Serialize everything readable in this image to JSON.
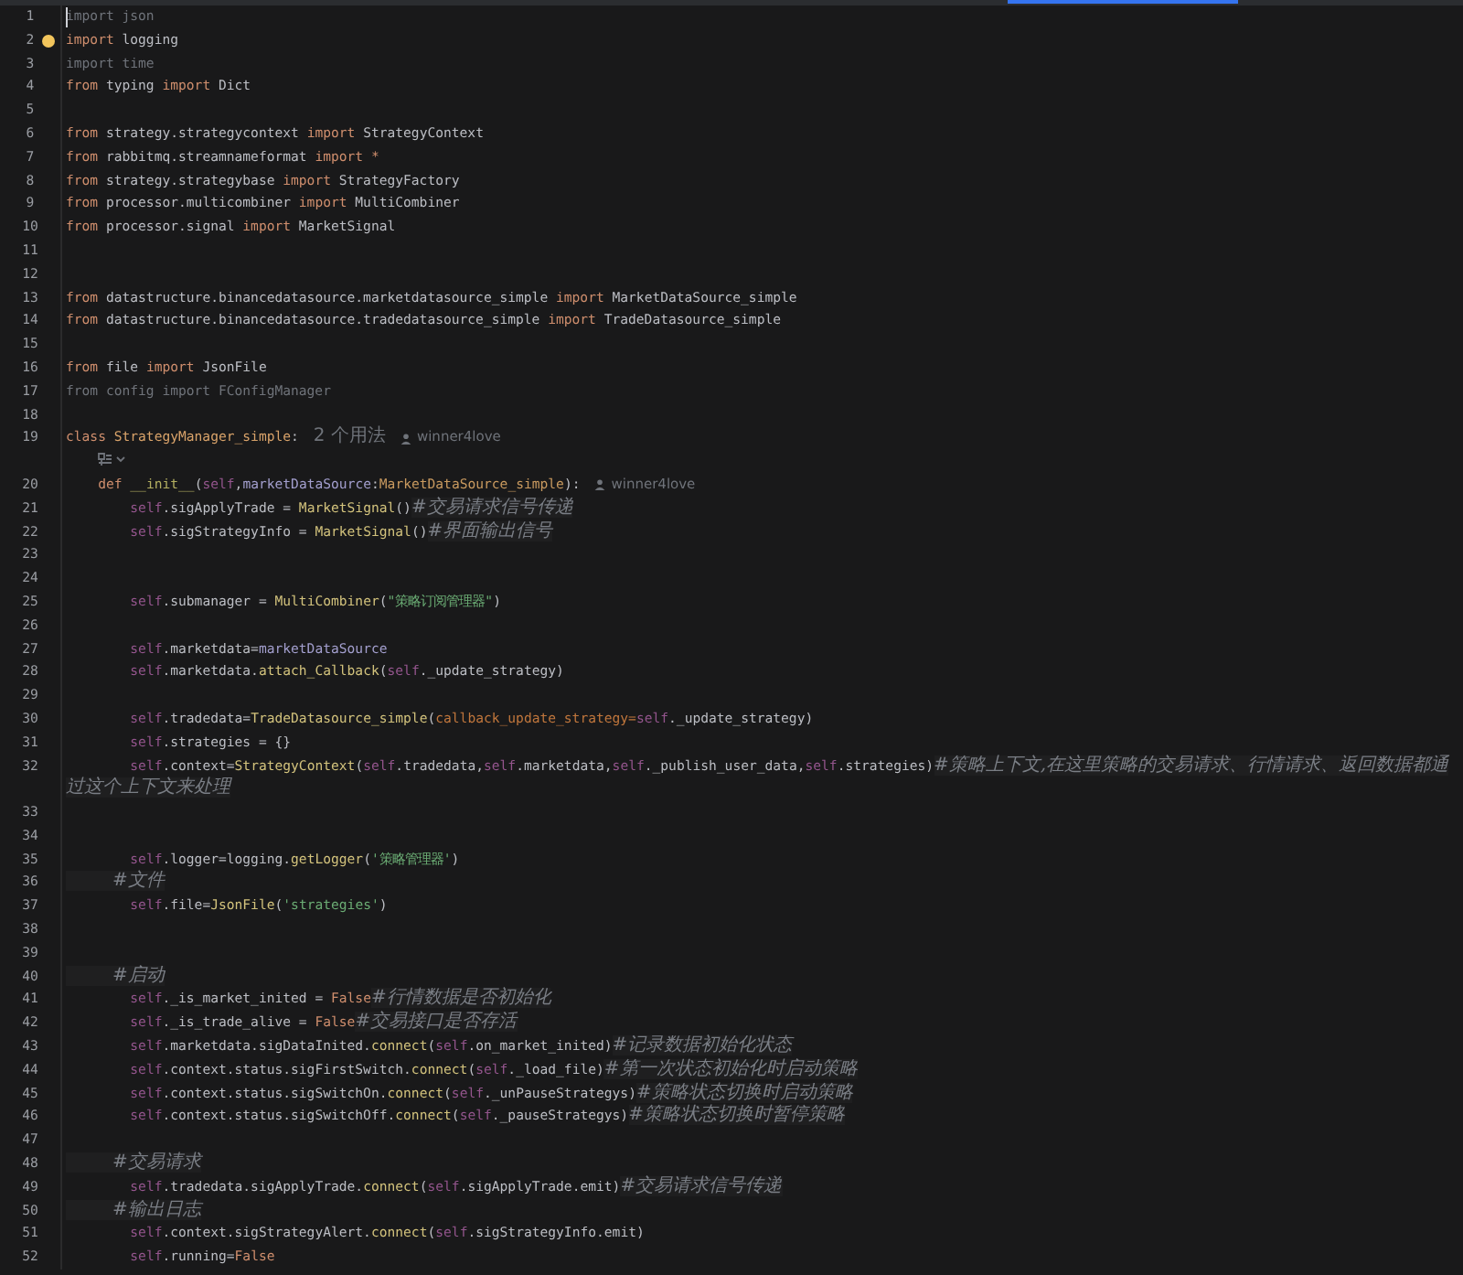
{
  "editor": {
    "lines": [
      {
        "kind": "code",
        "number": "1",
        "caret": true,
        "tokens": [
          {
            "kind": "dim",
            "text": "import json"
          }
        ]
      },
      {
        "kind": "code",
        "number": "2",
        "bulb": true,
        "tokens": [
          {
            "kind": "kw",
            "text": "import"
          },
          {
            "kind": "plain",
            "text": " logging"
          }
        ]
      },
      {
        "kind": "code",
        "number": "3",
        "tokens": [
          {
            "kind": "dim",
            "text": "import time"
          }
        ]
      },
      {
        "kind": "code",
        "number": "4",
        "tokens": [
          {
            "kind": "kw",
            "text": "from"
          },
          {
            "kind": "plain",
            "text": " typing "
          },
          {
            "kind": "kw",
            "text": "import"
          },
          {
            "kind": "plain",
            "text": " Dict"
          }
        ]
      },
      {
        "kind": "code",
        "number": "5"
      },
      {
        "kind": "code",
        "number": "6",
        "tokens": [
          {
            "kind": "kw",
            "text": "from"
          },
          {
            "kind": "plain",
            "text": " strategy.strategycontext "
          },
          {
            "kind": "kw",
            "text": "import"
          },
          {
            "kind": "plain",
            "text": " StrategyContext"
          }
        ]
      },
      {
        "kind": "code",
        "number": "7",
        "tokens": [
          {
            "kind": "kw",
            "text": "from"
          },
          {
            "kind": "plain",
            "text": " rabbitmq.streamnameformat "
          },
          {
            "kind": "kw",
            "text": "import"
          },
          {
            "kind": "kw",
            "text": " *"
          }
        ]
      },
      {
        "kind": "code",
        "number": "8",
        "tokens": [
          {
            "kind": "kw",
            "text": "from"
          },
          {
            "kind": "plain",
            "text": " strategy.strategybase "
          },
          {
            "kind": "kw",
            "text": "import"
          },
          {
            "kind": "plain",
            "text": " StrategyFactory"
          }
        ]
      },
      {
        "kind": "code",
        "number": "9",
        "tokens": [
          {
            "kind": "kw",
            "text": "from"
          },
          {
            "kind": "plain",
            "text": " processor.multicombiner "
          },
          {
            "kind": "kw",
            "text": "import"
          },
          {
            "kind": "plain",
            "text": " MultiCombiner"
          }
        ]
      },
      {
        "kind": "code",
        "number": "10",
        "tokens": [
          {
            "kind": "kw",
            "text": "from"
          },
          {
            "kind": "plain",
            "text": " processor.signal "
          },
          {
            "kind": "kw",
            "text": "import"
          },
          {
            "kind": "plain",
            "text": " MarketSignal"
          }
        ]
      },
      {
        "kind": "code",
        "number": "11"
      },
      {
        "kind": "code",
        "number": "12"
      },
      {
        "kind": "code",
        "number": "13",
        "tokens": [
          {
            "kind": "kw",
            "text": "from"
          },
          {
            "kind": "plain",
            "text": " datastructure.binancedatasource.marketdatasource_simple "
          },
          {
            "kind": "kw",
            "text": "import"
          },
          {
            "kind": "plain",
            "text": " MarketDataSource_simple"
          }
        ]
      },
      {
        "kind": "code",
        "number": "14",
        "tokens": [
          {
            "kind": "kw",
            "text": "from"
          },
          {
            "kind": "plain",
            "text": " datastructure.binancedatasource.tradedatasource_simple "
          },
          {
            "kind": "kw",
            "text": "import"
          },
          {
            "kind": "plain",
            "text": " TradeDatasource_simple"
          }
        ]
      },
      {
        "kind": "code",
        "number": "15"
      },
      {
        "kind": "code",
        "number": "16",
        "tokens": [
          {
            "kind": "kw",
            "text": "from"
          },
          {
            "kind": "plain",
            "text": " file "
          },
          {
            "kind": "kw",
            "text": "import"
          },
          {
            "kind": "plain",
            "text": " JsonFile"
          }
        ]
      },
      {
        "kind": "code",
        "number": "17",
        "tokens": [
          {
            "kind": "dim",
            "text": "from config import FConfigManager"
          }
        ]
      },
      {
        "kind": "code",
        "number": "18"
      },
      {
        "kind": "code",
        "number": "19",
        "tokens": [
          {
            "kind": "kw",
            "text": "class"
          },
          {
            "kind": "cls",
            "text": " StrategyManager_simple"
          },
          {
            "kind": "plain",
            "text": ":"
          }
        ],
        "hints": [
          {
            "kind": "usages",
            "text": "2 个用法"
          },
          {
            "kind": "author",
            "text": "winner4love"
          }
        ]
      },
      {
        "kind": "inlay"
      },
      {
        "kind": "code",
        "number": "20",
        "tokens": [
          {
            "kind": "kw",
            "text": "    def"
          },
          {
            "kind": "magic",
            "text": " __init__"
          },
          {
            "kind": "plain",
            "text": "("
          },
          {
            "kind": "self",
            "text": "self"
          },
          {
            "kind": "plain",
            "text": ","
          },
          {
            "kind": "param",
            "text": "marketDataSource"
          },
          {
            "kind": "plain",
            "text": ":"
          },
          {
            "kind": "type",
            "text": "MarketDataSource_simple"
          },
          {
            "kind": "plain",
            "text": "):"
          }
        ],
        "hints": [
          {
            "kind": "author",
            "text": "winner4love"
          }
        ]
      },
      {
        "kind": "code",
        "number": "21",
        "tokens": [
          {
            "kind": "self",
            "text": "        self"
          },
          {
            "kind": "plain",
            "text": ".sigApplyTrade = "
          },
          {
            "kind": "call",
            "text": "MarketSignal"
          },
          {
            "kind": "plain",
            "text": "()"
          },
          {
            "kind": "comment",
            "text": "#交易请求信号传递"
          }
        ]
      },
      {
        "kind": "code",
        "number": "22",
        "tokens": [
          {
            "kind": "self",
            "text": "        self"
          },
          {
            "kind": "plain",
            "text": ".sigStrategyInfo = "
          },
          {
            "kind": "call",
            "text": "MarketSignal"
          },
          {
            "kind": "plain",
            "text": "()"
          },
          {
            "kind": "comment",
            "text": "#界面输出信号"
          }
        ]
      },
      {
        "kind": "code",
        "number": "23"
      },
      {
        "kind": "code",
        "number": "24"
      },
      {
        "kind": "code",
        "number": "25",
        "tokens": [
          {
            "kind": "self",
            "text": "        self"
          },
          {
            "kind": "plain",
            "text": ".submanager = "
          },
          {
            "kind": "call",
            "text": "MultiCombiner"
          },
          {
            "kind": "plain",
            "text": "("
          },
          {
            "kind": "str",
            "text": "\"策略订阅管理器\""
          },
          {
            "kind": "plain",
            "text": ")"
          }
        ]
      },
      {
        "kind": "code",
        "number": "26"
      },
      {
        "kind": "code",
        "number": "27",
        "tokens": [
          {
            "kind": "self",
            "text": "        self"
          },
          {
            "kind": "plain",
            "text": ".marketdata="
          },
          {
            "kind": "param",
            "text": "marketDataSource"
          }
        ]
      },
      {
        "kind": "code",
        "number": "28",
        "tokens": [
          {
            "kind": "self",
            "text": "        self"
          },
          {
            "kind": "plain",
            "text": ".marketdata."
          },
          {
            "kind": "call",
            "text": "attach_Callback"
          },
          {
            "kind": "plain",
            "text": "("
          },
          {
            "kind": "self",
            "text": "self"
          },
          {
            "kind": "plain",
            "text": "._update_strategy)"
          }
        ]
      },
      {
        "kind": "code",
        "number": "29"
      },
      {
        "kind": "code",
        "number": "30",
        "tokens": [
          {
            "kind": "self",
            "text": "        self"
          },
          {
            "kind": "plain",
            "text": ".tradedata="
          },
          {
            "kind": "call",
            "text": "TradeDatasource_simple"
          },
          {
            "kind": "plain",
            "text": "("
          },
          {
            "kind": "kwarg",
            "text": "callback_update_strategy="
          },
          {
            "kind": "self",
            "text": "self"
          },
          {
            "kind": "plain",
            "text": "._update_strategy)"
          }
        ]
      },
      {
        "kind": "code",
        "number": "31",
        "tokens": [
          {
            "kind": "self",
            "text": "        self"
          },
          {
            "kind": "plain",
            "text": ".strategies = {}"
          }
        ]
      },
      {
        "kind": "code",
        "number": "32",
        "tokens": [
          {
            "kind": "self",
            "text": "        self"
          },
          {
            "kind": "plain",
            "text": ".context="
          },
          {
            "kind": "call",
            "text": "StrategyContext"
          },
          {
            "kind": "plain",
            "text": "("
          },
          {
            "kind": "self",
            "text": "self"
          },
          {
            "kind": "plain",
            "text": ".tradedata,"
          },
          {
            "kind": "self",
            "text": "self"
          },
          {
            "kind": "plain",
            "text": ".marketdata,"
          },
          {
            "kind": "self",
            "text": "self"
          },
          {
            "kind": "plain",
            "text": "._publish_user_data,"
          },
          {
            "kind": "self",
            "text": "self"
          },
          {
            "kind": "plain",
            "text": ".strategies)"
          },
          {
            "kind": "comment",
            "text": "#策略上下文,在这里策略的交易请求、行情请求、返回数据都通过这个上下文来处理"
          }
        ]
      },
      {
        "kind": "code",
        "number": "33"
      },
      {
        "kind": "code",
        "number": "34"
      },
      {
        "kind": "code",
        "number": "35",
        "tokens": [
          {
            "kind": "self",
            "text": "        self"
          },
          {
            "kind": "plain",
            "text": ".logger=logging."
          },
          {
            "kind": "call",
            "text": "getLogger"
          },
          {
            "kind": "plain",
            "text": "("
          },
          {
            "kind": "str",
            "text": "'策略管理器'"
          },
          {
            "kind": "plain",
            "text": ")"
          }
        ]
      },
      {
        "kind": "code",
        "number": "36",
        "tokens": [
          {
            "kind": "comment",
            "text": "        #文件"
          }
        ]
      },
      {
        "kind": "code",
        "number": "37",
        "tokens": [
          {
            "kind": "self",
            "text": "        self"
          },
          {
            "kind": "plain",
            "text": ".file="
          },
          {
            "kind": "call",
            "text": "JsonFile"
          },
          {
            "kind": "plain",
            "text": "("
          },
          {
            "kind": "str",
            "text": "'strategies'"
          },
          {
            "kind": "plain",
            "text": ")"
          }
        ]
      },
      {
        "kind": "code",
        "number": "38"
      },
      {
        "kind": "code",
        "number": "39"
      },
      {
        "kind": "code",
        "number": "40",
        "tokens": [
          {
            "kind": "comment",
            "text": "        #启动"
          }
        ]
      },
      {
        "kind": "code",
        "number": "41",
        "tokens": [
          {
            "kind": "self",
            "text": "        self"
          },
          {
            "kind": "plain",
            "text": "._is_market_inited = "
          },
          {
            "kind": "kw",
            "text": "False"
          },
          {
            "kind": "comment",
            "text": "#行情数据是否初始化"
          }
        ]
      },
      {
        "kind": "code",
        "number": "42",
        "tokens": [
          {
            "kind": "self",
            "text": "        self"
          },
          {
            "kind": "plain",
            "text": "._is_trade_alive = "
          },
          {
            "kind": "kw",
            "text": "False"
          },
          {
            "kind": "comment",
            "text": "#交易接口是否存活"
          }
        ]
      },
      {
        "kind": "code",
        "number": "43",
        "tokens": [
          {
            "kind": "self",
            "text": "        self"
          },
          {
            "kind": "plain",
            "text": ".marketdata.sigDataInited."
          },
          {
            "kind": "call",
            "text": "connect"
          },
          {
            "kind": "plain",
            "text": "("
          },
          {
            "kind": "self",
            "text": "self"
          },
          {
            "kind": "plain",
            "text": ".on_market_inited)"
          },
          {
            "kind": "comment",
            "text": "#记录数据初始化状态"
          }
        ]
      },
      {
        "kind": "code",
        "number": "44",
        "tokens": [
          {
            "kind": "self",
            "text": "        self"
          },
          {
            "kind": "plain",
            "text": ".context.status.sigFirstSwitch."
          },
          {
            "kind": "call",
            "text": "connect"
          },
          {
            "kind": "plain",
            "text": "("
          },
          {
            "kind": "self",
            "text": "self"
          },
          {
            "kind": "plain",
            "text": "._load_file)"
          },
          {
            "kind": "comment",
            "text": "#第一次状态初始化时启动策略"
          }
        ]
      },
      {
        "kind": "code",
        "number": "45",
        "tokens": [
          {
            "kind": "self",
            "text": "        self"
          },
          {
            "kind": "plain",
            "text": ".context.status.sigSwitchOn."
          },
          {
            "kind": "call",
            "text": "connect"
          },
          {
            "kind": "plain",
            "text": "("
          },
          {
            "kind": "self",
            "text": "self"
          },
          {
            "kind": "plain",
            "text": "._unPauseStrategys)"
          },
          {
            "kind": "comment",
            "text": "#策略状态切换时启动策略"
          }
        ]
      },
      {
        "kind": "code",
        "number": "46",
        "tokens": [
          {
            "kind": "self",
            "text": "        self"
          },
          {
            "kind": "plain",
            "text": ".context.status.sigSwitchOff."
          },
          {
            "kind": "call",
            "text": "connect"
          },
          {
            "kind": "plain",
            "text": "("
          },
          {
            "kind": "self",
            "text": "self"
          },
          {
            "kind": "plain",
            "text": "._pauseStrategys)"
          },
          {
            "kind": "comment",
            "text": "#策略状态切换时暂停策略"
          }
        ]
      },
      {
        "kind": "code",
        "number": "47"
      },
      {
        "kind": "code",
        "number": "48",
        "tokens": [
          {
            "kind": "comment",
            "text": "        #交易请求"
          }
        ]
      },
      {
        "kind": "code",
        "number": "49",
        "tokens": [
          {
            "kind": "self",
            "text": "        self"
          },
          {
            "kind": "plain",
            "text": ".tradedata.sigApplyTrade."
          },
          {
            "kind": "call",
            "text": "connect"
          },
          {
            "kind": "plain",
            "text": "("
          },
          {
            "kind": "self",
            "text": "self"
          },
          {
            "kind": "plain",
            "text": ".sigApplyTrade.emit)"
          },
          {
            "kind": "comment",
            "text": "#交易请求信号传递"
          }
        ]
      },
      {
        "kind": "code",
        "number": "50",
        "tokens": [
          {
            "kind": "comment",
            "text": "        #输出日志"
          }
        ]
      },
      {
        "kind": "code",
        "number": "51",
        "tokens": [
          {
            "kind": "self",
            "text": "        self"
          },
          {
            "kind": "plain",
            "text": ".context.sigStrategyAlert."
          },
          {
            "kind": "call",
            "text": "connect"
          },
          {
            "kind": "plain",
            "text": "("
          },
          {
            "kind": "self",
            "text": "self"
          },
          {
            "kind": "plain",
            "text": ".sigStrategyInfo.emit)"
          }
        ]
      },
      {
        "kind": "code",
        "number": "52",
        "tokens": [
          {
            "kind": "self",
            "text": "        self"
          },
          {
            "kind": "plain",
            "text": ".running="
          },
          {
            "kind": "kw",
            "text": "False"
          }
        ]
      }
    ]
  }
}
